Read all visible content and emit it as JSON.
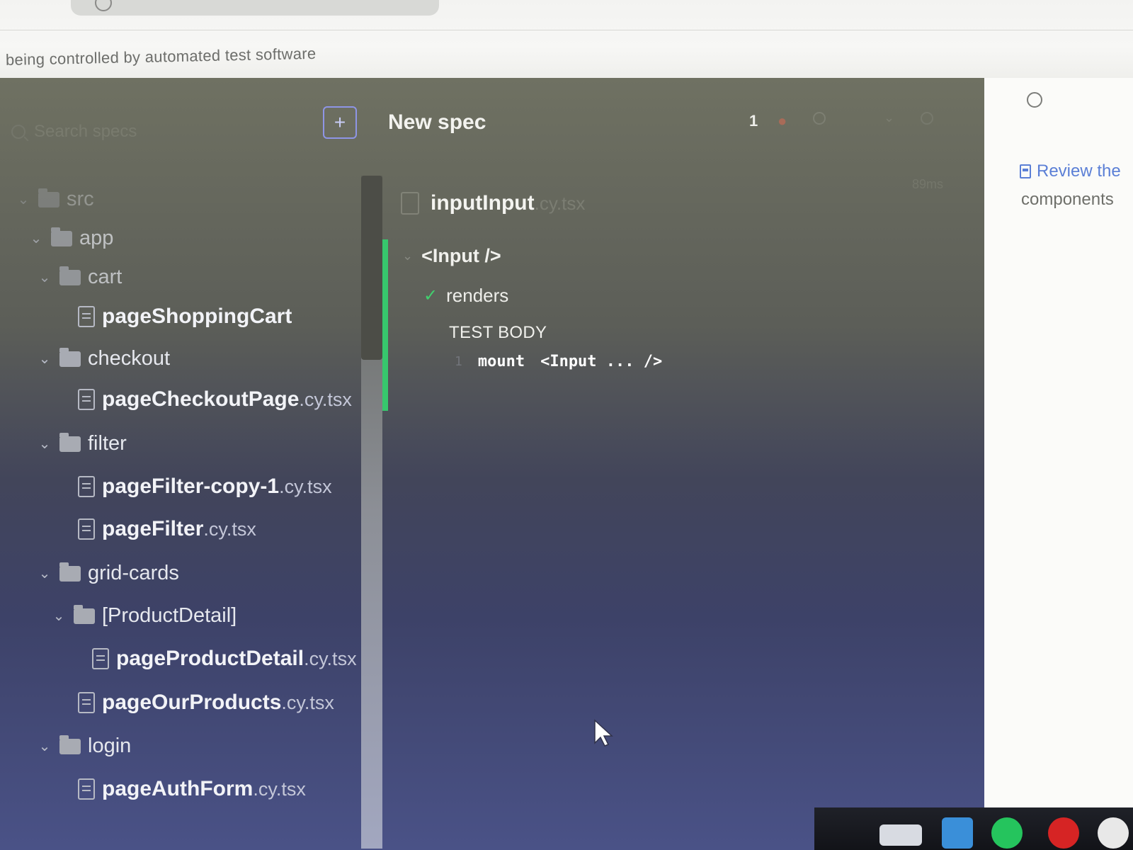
{
  "browser": {
    "automation_banner": "being controlled by automated test software"
  },
  "specs": {
    "search_placeholder": "Search specs",
    "new_spec_icon": "plus-icon",
    "tree": [
      {
        "type": "folder",
        "label": "src",
        "level": 0,
        "state": "dim"
      },
      {
        "type": "folder",
        "label": "app",
        "level": 1,
        "state": "semidim"
      },
      {
        "type": "folder",
        "label": "cart",
        "level": 2,
        "state": "semidim"
      },
      {
        "type": "file",
        "name": "pageShoppingCart",
        "ext": "",
        "level": 3
      },
      {
        "type": "folder",
        "label": "checkout",
        "level": 2
      },
      {
        "type": "file",
        "name": "pageCheckoutPage",
        "ext": ".cy.tsx",
        "level": 3
      },
      {
        "type": "folder",
        "label": "filter",
        "level": 2
      },
      {
        "type": "file",
        "name": "pageFilter-copy-1",
        "ext": ".cy.tsx",
        "level": 3
      },
      {
        "type": "file",
        "name": "pageFilter",
        "ext": ".cy.tsx",
        "level": 3
      },
      {
        "type": "folder",
        "label": "grid-cards",
        "level": 2
      },
      {
        "type": "folder",
        "label": "[ProductDetail]",
        "level": 3
      },
      {
        "type": "file",
        "name": "pageProductDetail",
        "ext": ".cy.tsx",
        "level": 4
      },
      {
        "type": "file",
        "name": "pageOurProducts",
        "ext": ".cy.tsx",
        "level": 3
      },
      {
        "type": "folder",
        "label": "login",
        "level": 2
      },
      {
        "type": "file",
        "name": "pageAuthForm",
        "ext": ".cy.tsx",
        "level": 3
      }
    ]
  },
  "reporter": {
    "header_label": "New spec",
    "stats": {
      "passed": "1"
    },
    "spec_file": {
      "name": "inputInput",
      "ext": ".cy.tsx"
    },
    "duration": "89ms",
    "suite": "<Input />",
    "test": "renders",
    "test_body_label": "TEST BODY",
    "command": {
      "number": "1",
      "name": "mount",
      "message": "<Input ... />"
    }
  },
  "right_pane": {
    "docs_link": "Review the",
    "docs_text": "components"
  },
  "colors": {
    "passed": "#37c76d",
    "failed": "#d06a54",
    "link": "#5b7fd6",
    "accent": "#8e95e6"
  }
}
